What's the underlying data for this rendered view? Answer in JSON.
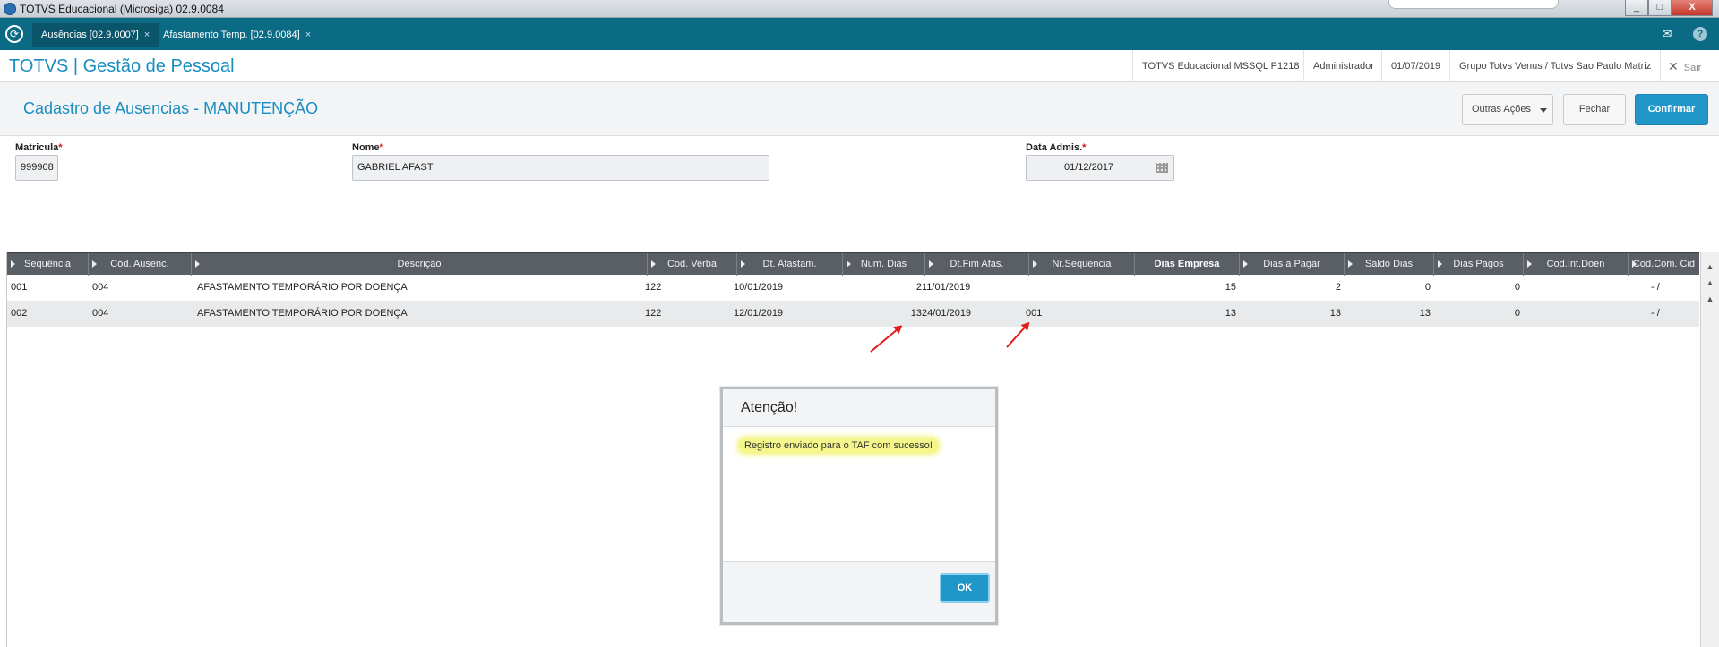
{
  "window": {
    "title": "TOTVS Educacional (Microsiga) 02.9.0084",
    "controls": {
      "minimize": "_",
      "maximize": "□",
      "close": "X"
    }
  },
  "tabs": [
    {
      "label": "Ausências [02.9.0007]",
      "close": "×"
    },
    {
      "label": "Afastamento Temp. [02.9.0084]",
      "close": "×"
    }
  ],
  "header": {
    "brand": "TOTVS | Gestão de Pessoal",
    "environment": "TOTVS Educacional MSSQL P1218",
    "user": "Administrador",
    "date": "01/07/2019",
    "company": "Grupo Totvs Venus / Totvs Sao Paulo Matriz",
    "logout": "Sair"
  },
  "page": {
    "title": "Cadastro de Ausencias - MANUTENÇÃO",
    "buttons": {
      "outras_acoes": "Outras Ações",
      "fechar": "Fechar",
      "confirmar": "Confirmar"
    }
  },
  "form": {
    "matricula": {
      "label": "Matricula",
      "required": "*",
      "value": "999908"
    },
    "nome": {
      "label": "Nome",
      "required": "*",
      "value": "GABRIEL AFAST"
    },
    "data_admis": {
      "label": "Data Admis.",
      "required": "*",
      "value": "01/12/2017"
    }
  },
  "grid": {
    "columns": [
      "Sequência",
      "Cód. Ausenc.",
      "Descrição",
      "Cod. Verba",
      "Dt. Afastam.",
      "Num. Dias",
      "Dt.Fim Afas.",
      "Nr.Sequencia",
      "Dias Empresa",
      "Dias a Pagar",
      "Saldo Dias",
      "Dias Pagos",
      "Cod.Int.Doen",
      "Cod.Com. Cid"
    ],
    "rows": [
      {
        "seq": "001",
        "cod": "004",
        "desc": "AFASTAMENTO TEMPORÁRIO POR DOENÇA",
        "verba": "122",
        "dt_afast": "10/01/2019",
        "num_dias": "2",
        "dt_fim": "11/01/2019",
        "nr_seq": "",
        "dias_emp": "15",
        "dias_pagar": "2",
        "saldo": "0",
        "pagos": "0",
        "cod_int": "",
        "cod_com": "- /"
      },
      {
        "seq": "002",
        "cod": "004",
        "desc": "AFASTAMENTO TEMPORÁRIO POR DOENÇA",
        "verba": "122",
        "dt_afast": "12/01/2019",
        "num_dias": "13",
        "dt_fim": "24/01/2019",
        "nr_seq": "001",
        "dias_emp": "13",
        "dias_pagar": "13",
        "saldo": "13",
        "pagos": "0",
        "cod_int": "",
        "cod_com": "- /"
      }
    ]
  },
  "dialog": {
    "title": "Atenção!",
    "message": "Registro enviado para o TAF com sucesso!",
    "ok": "OK"
  },
  "colors": {
    "accent": "#1a8dc2",
    "tabbar": "#0b6b85",
    "grid_header": "#5a5f65",
    "highlight": "#f4f58a",
    "annotation_arrow": "#e21b1b"
  },
  "icons": [
    "app-icon",
    "home-icon",
    "mail-icon",
    "help-icon",
    "close-icon",
    "calendar-icon",
    "sort-triangle-icon",
    "caret-down-icon"
  ]
}
